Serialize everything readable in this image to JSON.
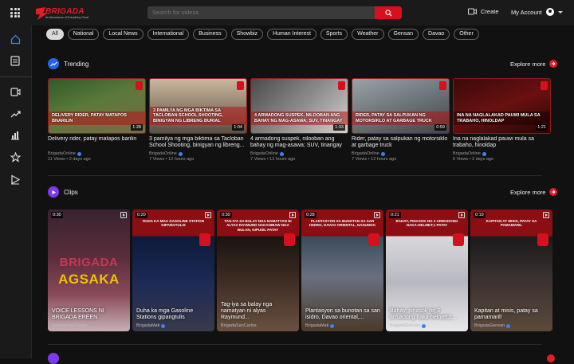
{
  "header": {
    "logo_word": "BRIGADA",
    "logo_tagline": "An Abundance of Everything Great",
    "search_placeholder": "Search for videos",
    "create_label": "Create",
    "account_label": "My Account"
  },
  "categories": [
    "All",
    "National",
    "Local News",
    "International",
    "Business",
    "Showbiz",
    "Human Interest",
    "Sports",
    "Weather",
    "Gensan",
    "Davao",
    "Other"
  ],
  "trending": {
    "title": "Trending",
    "explore_label": "Explore more",
    "videos": [
      {
        "title": "Delivery rider, patay matapos barilin",
        "channel": "BrigadaOnline",
        "meta": "11 Views • 2 days ago",
        "duration": "1:28",
        "banner": "DELIVERY RIDER, PATAY MATAPOS BNARILIN"
      },
      {
        "title": "3 pamilya ng mga biktima sa Tacloban School Shooting, binigyan ng libreng...",
        "channel": "BrigadaOnline",
        "meta": "7 Views • 12 hours ago",
        "duration": "1:04",
        "banner": "3 PAMILYA NG MGA BIKTIMA SA TACLOBAN SCHOOL SHOOTING, BINIGYAN NG LIBRENG BURIAL"
      },
      {
        "title": "4 armadong suspek, nilooban ang bahay ng mag-asawa; SUV, tinangay",
        "channel": "BrigadaOnline",
        "meta": "7 Views • 12 hours ago",
        "duration": "1:33",
        "banner": "4 ARMADONG SUSPEK, NILOOBAN ANG BAHAY NG MAG-ASAWA; SUV, TINANGAY"
      },
      {
        "title": "Rider, patay sa salpukan ng motorsiklo at garbage truck",
        "channel": "BrigadaOnline",
        "meta": "7 Views • 12 hours ago",
        "duration": "0:59",
        "banner": "RIDER, PATAY SA SALPUKAN NG MOTORSIKLO AT GARBAGE TRUCK"
      },
      {
        "title": "Ina na naglalakad pauwi mula sa trabaho, hinoldap",
        "channel": "BrigadaOnline",
        "meta": "6 Views • 2 days ago",
        "duration": "1:21",
        "banner": "INA NA NAGLALAKAD PAUWI MULA SA TRABAHO, HINOLDAP"
      }
    ]
  },
  "clips": {
    "title": "Clips",
    "explore_label": "Explore more",
    "items": [
      {
        "time": "0:30",
        "title": "VOICE LESSONS NI BRIGADA EREEN",
        "channel": "BrigadaSanCarlos",
        "head": "",
        "big1": "BRIGADA",
        "big2": "AGSAKA"
      },
      {
        "time": "0:20",
        "title": "Duha ka mga Gasoline Stations gipangtulis",
        "channel": "BrigadaMati",
        "head": "DUHA KA MGA GASOLINE STATION GIPANGTULIS"
      },
      {
        "time": "0:30",
        "title": "Tag-iya sa balay nga namatyan ni alyas Raymund...",
        "channel": "BrigadaSanCarlos",
        "head": "TAG-IYA SA BALAY NGA NAMATYAN NI ALYAS RAYMUND NAKAHIBAW NGA BULAN, GIPUSIL PATAY"
      },
      {
        "time": "0:28",
        "title": "Plantasyon sa bunotan sa san isidro, Davao oriental,...",
        "channel": "BrigadaMati",
        "head": "PLANTASYON SA BUNOTAN SA SAN ISIDRO, DAVAO ORIENTAL, NASUNOG"
      },
      {
        "time": "0:21",
        "title": "Bahay, pinasok ng 3 armadong naka-helmet;1...",
        "channel": "BrigadaGensan",
        "head": "BAHAY, PINASOK NG 3 ARMADONG NAKA-HELMET;1 PATAY"
      },
      {
        "time": "0:19",
        "title": "Kapitan at misis, patay sa pamamaril!",
        "channel": "BrigadaGensan",
        "head": "KAPITAN AT MISIS, PATAY SA PAMAMARIL"
      }
    ]
  },
  "colors": {
    "accent": "#d6101e",
    "background": "#111111",
    "sidebar": "#1a1a1a",
    "verified": "#3b82f6"
  }
}
